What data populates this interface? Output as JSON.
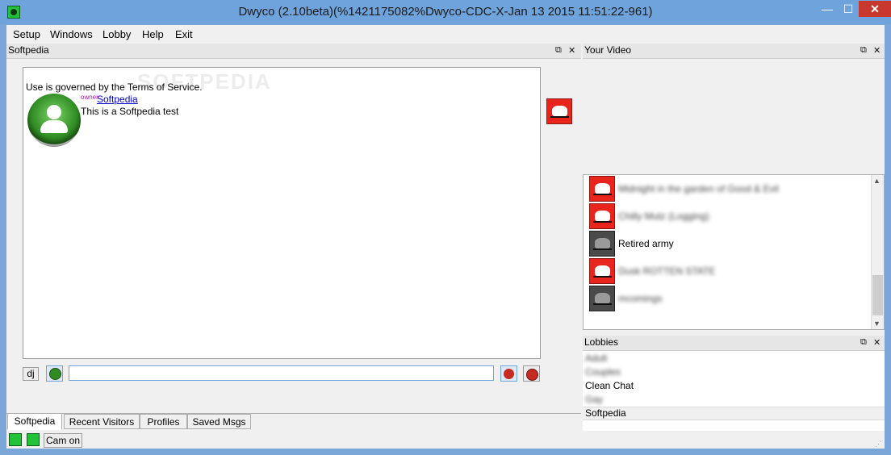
{
  "window": {
    "title": "Dwyco (2.10beta)(%1421175082%Dwyco-CDC-X-Jan 13 2015 11:51:22-961)",
    "min_glyph": "—",
    "max_glyph": "☐",
    "close_glyph": "✕"
  },
  "menu": [
    "Setup",
    "Windows",
    "Lobby",
    "Help",
    "Exit"
  ],
  "chat_panel": {
    "title": "Softpedia",
    "float_glyph": "⧉",
    "close_glyph": "✕",
    "tos_text": "Use is governed by the Terms of Service.",
    "owner_tag": "owner",
    "user_link": "Softpedia",
    "message": "This is a Softpedia test",
    "watermark": "SOFTPEDIA"
  },
  "input_bar": {
    "dj_label": "dj",
    "message_value": ""
  },
  "tabs": [
    {
      "label": "Softpedia",
      "active": true
    },
    {
      "label": "Recent Visitors",
      "active": false
    },
    {
      "label": "Profiles",
      "active": false
    },
    {
      "label": "Saved Msgs",
      "active": false
    }
  ],
  "status_bar": {
    "cam_button": "Cam on"
  },
  "video_panel": {
    "title": "Your Video",
    "float_glyph": "⧉",
    "close_glyph": "✕"
  },
  "user_list": [
    {
      "name": "Midnight in the garden of Good & Evil",
      "icon": "red-skull-icon",
      "blurred": true
    },
    {
      "name": "Chilly Mutz (Logging)",
      "icon": "red-skull-icon",
      "blurred": true
    },
    {
      "name": "Retired army",
      "icon": "dark-skull-icon",
      "blurred": false
    },
    {
      "name": "Dusk ROTTEN STATE",
      "icon": "red-skull-icon",
      "blurred": true
    },
    {
      "name": "mcomings",
      "icon": "dark-skull-icon",
      "blurred": true
    }
  ],
  "lobbies_panel": {
    "title": "Lobbies",
    "float_glyph": "⧉",
    "close_glyph": "✕",
    "items": [
      {
        "label": "Adult",
        "blurred": true
      },
      {
        "label": "Couples",
        "blurred": true
      },
      {
        "label": "Clean Chat",
        "blurred": false
      },
      {
        "label": "Gay",
        "blurred": true
      }
    ],
    "selected": "Softpedia"
  },
  "colors": {
    "titlebar": "#6fa3db",
    "close_red": "#c7392e",
    "skull_red": "#e9241c",
    "link_blue": "#0000cc",
    "owner_magenta": "#cc00cc"
  }
}
